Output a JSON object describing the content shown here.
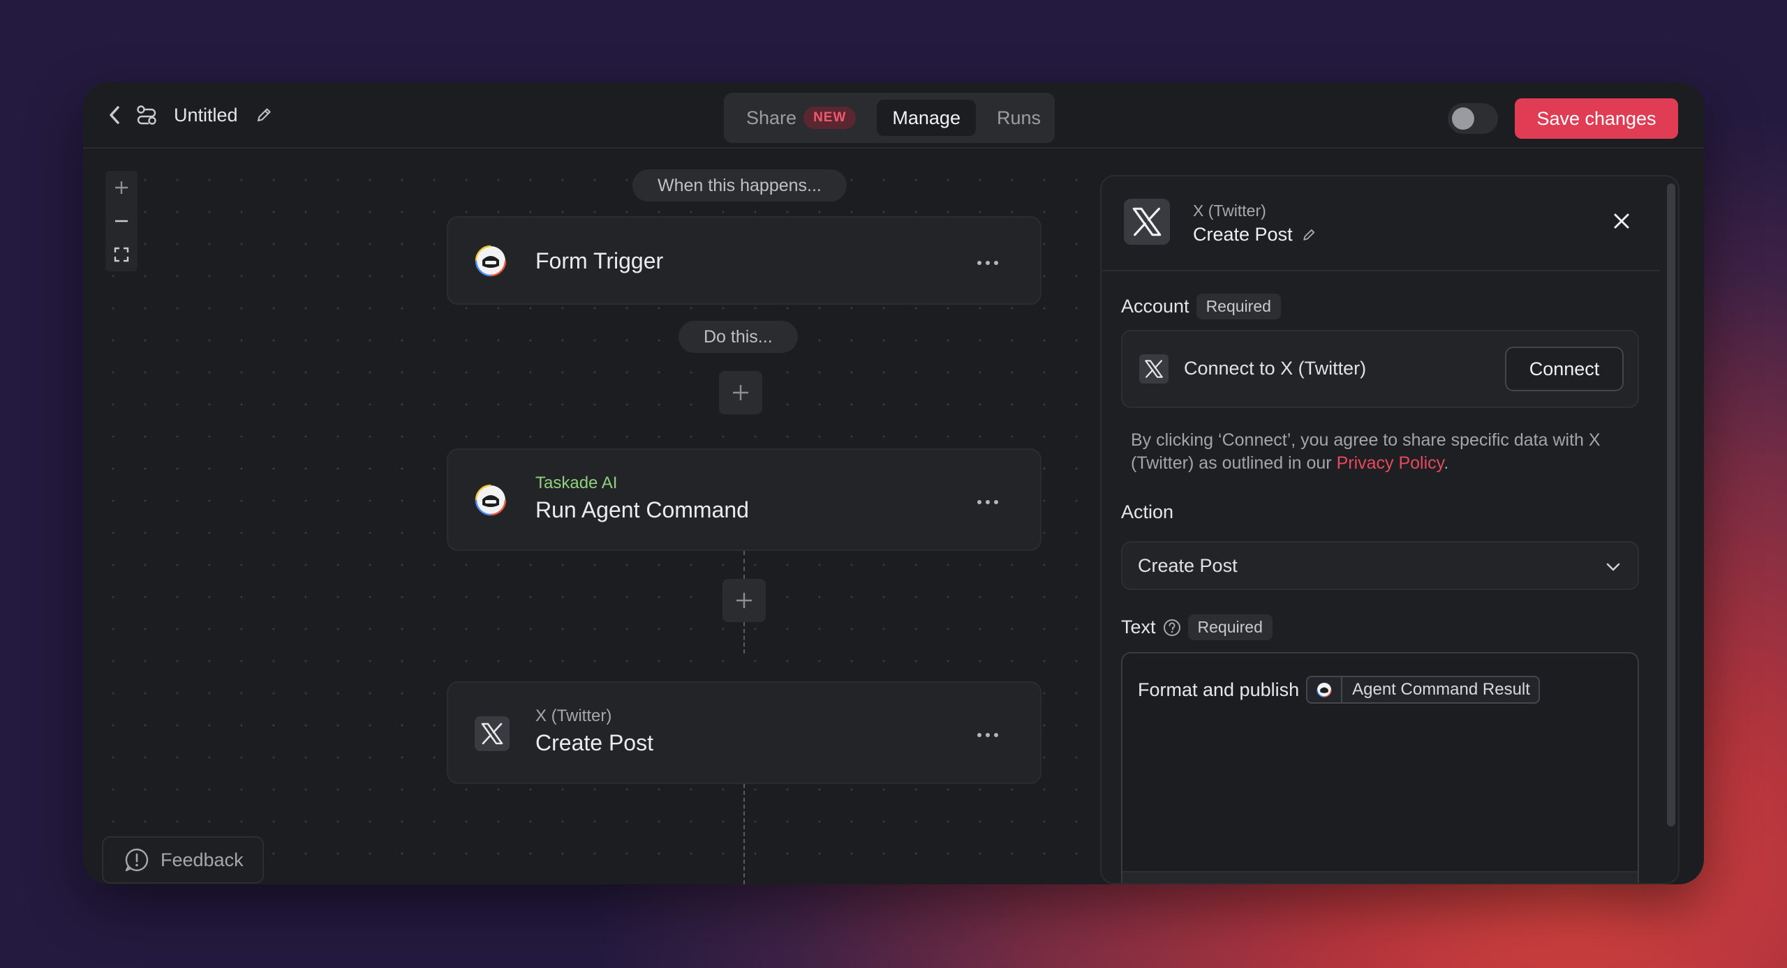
{
  "header": {
    "title": "Untitled",
    "tabs": [
      {
        "label": "Share",
        "badge": "NEW"
      },
      {
        "label": "Manage"
      },
      {
        "label": "Runs"
      }
    ],
    "save_label": "Save changes"
  },
  "canvas": {
    "trigger_pill": "When this happens...",
    "action_pill": "Do this...",
    "nodes": [
      {
        "label": "Form Trigger"
      },
      {
        "app": "Taskade AI",
        "label": "Run Agent Command"
      },
      {
        "app": "X (Twitter)",
        "label": "Create Post"
      }
    ],
    "feedback_label": "Feedback"
  },
  "panel": {
    "app": "X (Twitter)",
    "title": "Create Post",
    "account": {
      "label": "Account",
      "required": "Required",
      "connect_text": "Connect to X (Twitter)",
      "connect_button": "Connect"
    },
    "disclaimer_pre": "By clicking ‘Connect’, you agree to share specific data with X (Twitter) as outlined in our ",
    "disclaimer_link": "Privacy Policy",
    "disclaimer_post": ".",
    "action": {
      "label": "Action",
      "selected": "Create Post"
    },
    "text": {
      "label": "Text",
      "required": "Required",
      "value_prefix": "Format and publish",
      "chip_label": "Agent Command Result"
    }
  },
  "colors": {
    "accent": "#e03d55",
    "taskade_green": "#8fd17a"
  }
}
